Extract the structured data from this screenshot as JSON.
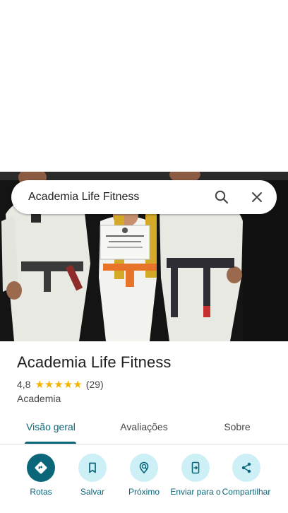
{
  "search": {
    "query": "Academia Life Fitness"
  },
  "place": {
    "name": "Academia Life Fitness",
    "rating": "4,8",
    "stars": "★★★★★",
    "review_count": "(29)",
    "category": "Academia"
  },
  "tabs": [
    {
      "label": "Visão geral",
      "active": true
    },
    {
      "label": "Avaliações",
      "active": false
    },
    {
      "label": "Sobre",
      "active": false
    }
  ],
  "actions": [
    {
      "label": "Rotas",
      "icon": "directions-icon"
    },
    {
      "label": "Salvar",
      "icon": "bookmark-icon"
    },
    {
      "label": "Próximo",
      "icon": "nearby-icon"
    },
    {
      "label": "Enviar para o",
      "icon": "send-to-phone-icon"
    },
    {
      "label": "Compartilhar",
      "icon": "share-icon"
    }
  ],
  "colors": {
    "accent": "#0b6679",
    "action_bg": "#cdeff6",
    "star": "#f4b400"
  }
}
